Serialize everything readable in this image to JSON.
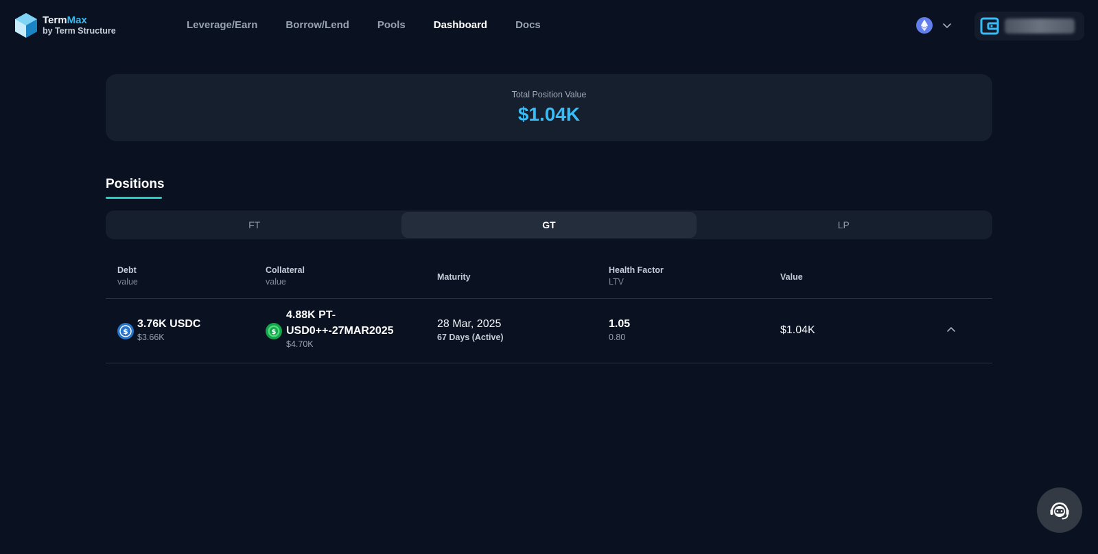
{
  "header": {
    "brand": {
      "name_part1": "Term",
      "name_part2": "Max",
      "subtitle": "by Term Structure"
    },
    "nav": [
      {
        "label": "Leverage/Earn",
        "active": false
      },
      {
        "label": "Borrow/Lend",
        "active": false
      },
      {
        "label": "Pools",
        "active": false
      },
      {
        "label": "Dashboard",
        "active": true
      },
      {
        "label": "Docs",
        "active": false
      }
    ],
    "chain_icon": "ethereum-icon",
    "wallet_icon": "wallet-icon"
  },
  "summary": {
    "label": "Total Position Value",
    "value": "$1.04K"
  },
  "positions": {
    "title": "Positions",
    "tabs": [
      {
        "label": "FT",
        "active": false
      },
      {
        "label": "GT",
        "active": true
      },
      {
        "label": "LP",
        "active": false
      }
    ],
    "columns": {
      "debt": {
        "label": "Debt",
        "sub": "value"
      },
      "collateral": {
        "label": "Collateral",
        "sub": "value"
      },
      "maturity": {
        "label": "Maturity"
      },
      "health": {
        "label": "Health Factor",
        "sub": "LTV"
      },
      "value": {
        "label": "Value"
      }
    },
    "rows": [
      {
        "debt": {
          "amount": "3.76K USDC",
          "value": "$3.66K",
          "icon": "usdc-icon"
        },
        "collateral": {
          "amount_line1": "4.88K PT-",
          "amount_line2": "USD0++-27MAR2025",
          "value": "$4.70K",
          "icon": "usd0-icon"
        },
        "maturity": {
          "date": "28 Mar, 2025",
          "status": "67 Days (Active)"
        },
        "health": {
          "factor": "1.05",
          "ltv": "0.80"
        },
        "value": "$1.04K"
      }
    ]
  },
  "colors": {
    "accent": "#38bdf8",
    "underline": "#22d3c5",
    "background": "#0a1222",
    "card": "#161f2e"
  }
}
